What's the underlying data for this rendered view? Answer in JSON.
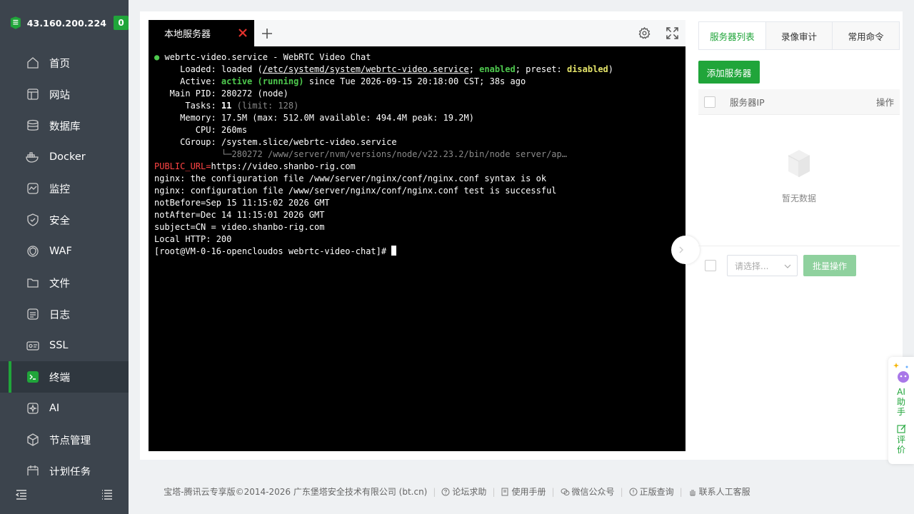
{
  "brand": {
    "ip": "43.160.200.224",
    "badge": "0"
  },
  "sidebar": {
    "items": [
      {
        "label": "首页",
        "icon": "home-icon"
      },
      {
        "label": "网站",
        "icon": "website-icon"
      },
      {
        "label": "数据库",
        "icon": "database-icon"
      },
      {
        "label": "Docker",
        "icon": "docker-icon"
      },
      {
        "label": "监控",
        "icon": "monitor-icon"
      },
      {
        "label": "安全",
        "icon": "shield-icon"
      },
      {
        "label": "WAF",
        "icon": "waf-icon"
      },
      {
        "label": "文件",
        "icon": "folder-icon"
      },
      {
        "label": "日志",
        "icon": "log-icon"
      },
      {
        "label": "SSL",
        "icon": "ssl-icon"
      },
      {
        "label": "终端",
        "icon": "terminal-icon",
        "active": true
      },
      {
        "label": "AI",
        "icon": "ai-icon"
      },
      {
        "label": "节点管理",
        "icon": "node-icon"
      },
      {
        "label": "计划任务",
        "icon": "calendar-icon"
      }
    ]
  },
  "terminal": {
    "tab_label": "本地服务器",
    "lines": {
      "l1_name": "webrtc-video.service - WebRTC Video Chat",
      "l2_pre": "     Loaded: loaded (",
      "l2_path": "/etc/systemd/system/webrtc-video.service",
      "l2_mid": "; ",
      "l2_enabled": "enabled",
      "l2_mid2": "; preset: ",
      "l2_disabled": "disabled",
      "l2_post": ")",
      "l3_pre": "     Active: ",
      "l3_active": "active (running)",
      "l3_post": " since Tue 2026-09-15 20:18:00 CST; 38s ago",
      "l4": "   Main PID: 280272 (node)",
      "l5_pre": "      Tasks: ",
      "l5_val": "11",
      "l5_post": " (limit: 128)",
      "l6": "     Memory: 17.5M (max: 512.0M available: 494.4M peak: 19.2M)",
      "l7": "        CPU: 260ms",
      "l8": "     CGroup: /system.slice/webrtc-video.service",
      "l9": "             └─280272 /www/server/nvm/versions/node/v22.23.2/bin/node server/ap…",
      "l10_key": "PUBLIC_URL=",
      "l10_val": "https://video.shanbo-rig.com",
      "l11": "nginx: the configuration file /www/server/nginx/conf/nginx.conf syntax is ok",
      "l12": "nginx: configuration file /www/server/nginx/conf/nginx.conf test is successful",
      "l13": "notBefore=Sep 15 11:15:02 2026 GMT",
      "l14": "notAfter=Dec 14 11:15:01 2026 GMT",
      "l15": "subject=CN = video.shanbo-rig.com",
      "l16": "Local HTTP: 200",
      "l17": "[root@VM-0-16-opencloudos webrtc-video-chat]# "
    }
  },
  "right_panel": {
    "tabs": [
      "服务器列表",
      "录像审计",
      "常用命令"
    ],
    "add_button": "添加服务器",
    "col_ip": "服务器IP",
    "col_action": "操作",
    "empty_text": "暂无数据",
    "select_placeholder": "请选择...",
    "batch_button": "批量操作"
  },
  "ai_float": {
    "ai_label": "AI\n助\n手",
    "review_label": "评\n价"
  },
  "footer": {
    "copyright": "宝塔-腾讯云专享版©2014-2026 广东堡塔安全技术有限公司 (bt.cn)",
    "links": [
      "论坛求助",
      "使用手册",
      "微信公众号",
      "正版查询",
      "联系人工客服"
    ]
  },
  "colors": {
    "accent": "#20a53a",
    "sidebar_bg": "#3c444d"
  }
}
